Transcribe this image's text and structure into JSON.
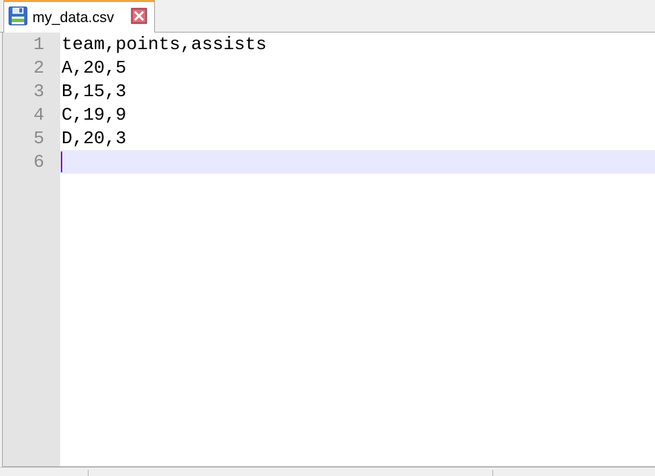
{
  "tab": {
    "filename": "my_data.csv",
    "save_icon": "floppy-disk-icon",
    "close_icon": "close-icon",
    "active_color": "#f7a23a",
    "close_color": "#c05060"
  },
  "editor": {
    "lines": [
      {
        "number": "1",
        "text": "team,points,assists"
      },
      {
        "number": "2",
        "text": "A,20,5"
      },
      {
        "number": "3",
        "text": "B,15,3"
      },
      {
        "number": "4",
        "text": "C,19,9"
      },
      {
        "number": "5",
        "text": "D,20,3"
      },
      {
        "number": "6",
        "text": ""
      }
    ],
    "current_line": 6,
    "current_line_color": "#e8e8ff",
    "caret_color": "#8000a0"
  }
}
